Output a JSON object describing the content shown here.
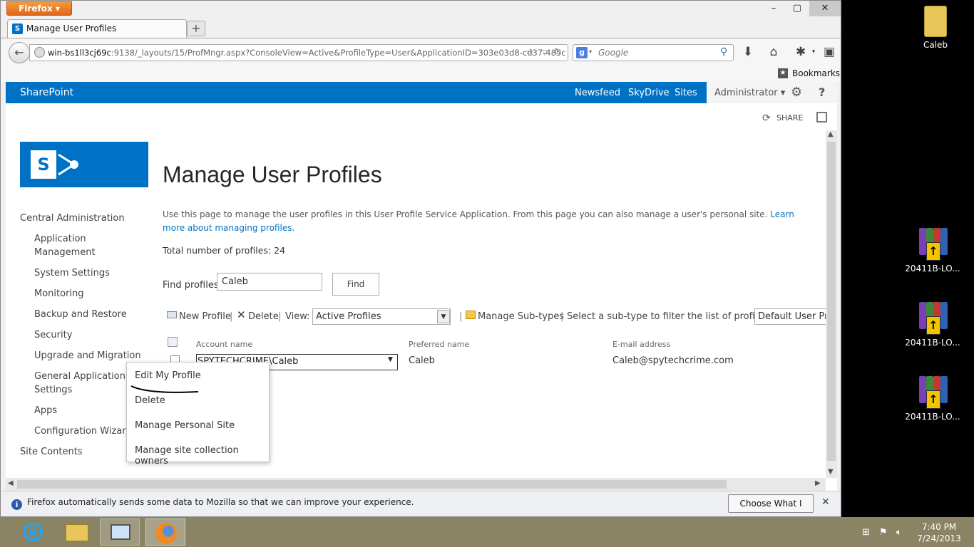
{
  "browser": {
    "app_button": "Firefox",
    "tab_title": "Manage User Profiles",
    "url_host": "win-bs1ll3cj69c",
    "url_rest": ":9138/_layouts/15/ProfMngr.aspx?ConsoleView=Active&ProfileType=User&ApplicationID=303e03d8-cd37-485c",
    "search_placeholder": "Google",
    "bookmarks_label": "Bookmarks"
  },
  "suite": {
    "brand": "SharePoint",
    "links": [
      "Newsfeed",
      "SkyDrive",
      "Sites"
    ],
    "user": "Administrator",
    "share_label": "SHARE"
  },
  "page": {
    "title": "Manage User Profiles",
    "description": "Use this page to manage the user profiles in this User Profile Service Application. From this page you can also manage a user's personal site.",
    "learn_more": "Learn more about managing profiles.",
    "total": "Total number of profiles: 24",
    "find_label": "Find profiles",
    "find_value": "Caleb",
    "find_button": "Find"
  },
  "toolbar": {
    "new_profile": "New Profile",
    "delete": "Delete",
    "view_label": "View:",
    "view_value": "Active Profiles",
    "manage_subtypes": "Manage Sub-types",
    "subtype_hint": "Select a sub-type to filter the list of profiles:",
    "subtype_value": "Default User Pro"
  },
  "table": {
    "headers": [
      "Account name",
      "Preferred name",
      "E-mail address"
    ],
    "rows": [
      {
        "account": "SPYTECHCRIME\\Caleb",
        "preferred": "Caleb",
        "email": "Caleb@spytechcrime.com"
      }
    ]
  },
  "leftnav": {
    "items": [
      {
        "label": "Central Administration"
      },
      {
        "label": "Application Management"
      },
      {
        "label": "System Settings"
      },
      {
        "label": "Monitoring"
      },
      {
        "label": "Backup and Restore"
      },
      {
        "label": "Security"
      },
      {
        "label": "Upgrade and Migration"
      },
      {
        "label": "General Application Settings"
      },
      {
        "label": "Apps"
      },
      {
        "label": "Configuration Wizards"
      },
      {
        "label": "Site Contents"
      }
    ]
  },
  "context_menu": {
    "items": [
      "Edit My Profile",
      "Delete",
      "Manage Personal Site",
      "Manage site collection owners"
    ]
  },
  "notification": {
    "text": "Firefox automatically sends some data to Mozilla so that we can improve your experience.",
    "button": "Choose What I Share"
  },
  "desktop": {
    "icons": [
      "Caleb",
      "20411B-LO...",
      "20411B-LO...",
      "20411B-LO..."
    ]
  },
  "taskbar": {
    "time": "7:40 PM",
    "date": "7/24/2013"
  }
}
